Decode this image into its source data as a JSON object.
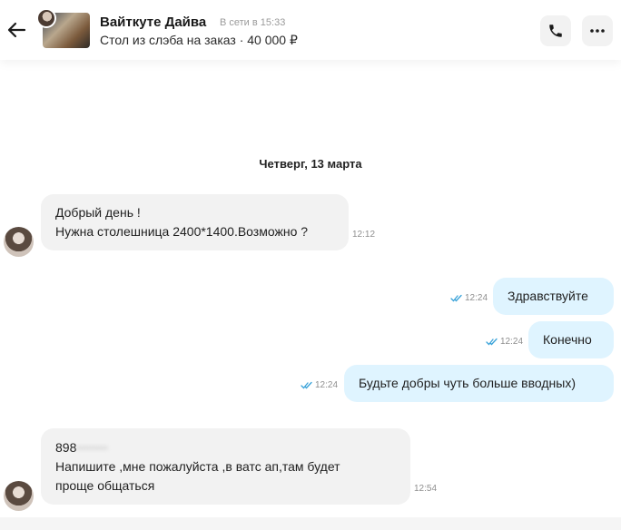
{
  "header": {
    "name": "Вайткуте Дайва",
    "status": "В сети в 15:33",
    "subtitle": "Стол из слэба на заказ · 40 000 ₽"
  },
  "chat": {
    "date_separator": "Четверг, 13 марта",
    "messages": [
      {
        "direction": "in",
        "lines": [
          "Добрый день !",
          "Нужна столешница 2400*1400.Возможно ?"
        ],
        "time": "12:12"
      },
      {
        "direction": "out",
        "text": "Здравствуйте",
        "time": "12:24",
        "read": true
      },
      {
        "direction": "out",
        "text": "Конечно",
        "time": "12:24",
        "read": true
      },
      {
        "direction": "out",
        "text": "Будьте добры чуть больше вводных)",
        "time": "12:24",
        "read": true
      },
      {
        "direction": "in",
        "phone_visible": "898",
        "phone_hidden": "•••••••",
        "lines": [
          "Напишите ,мне пожалуйста ,в ватс ап,там будет",
          "проще общаться"
        ],
        "time": "12:54"
      }
    ]
  },
  "colors": {
    "incoming": "#f2f2f2",
    "outgoing": "#dff4ff",
    "read_ticks": "#3aa3d9"
  }
}
